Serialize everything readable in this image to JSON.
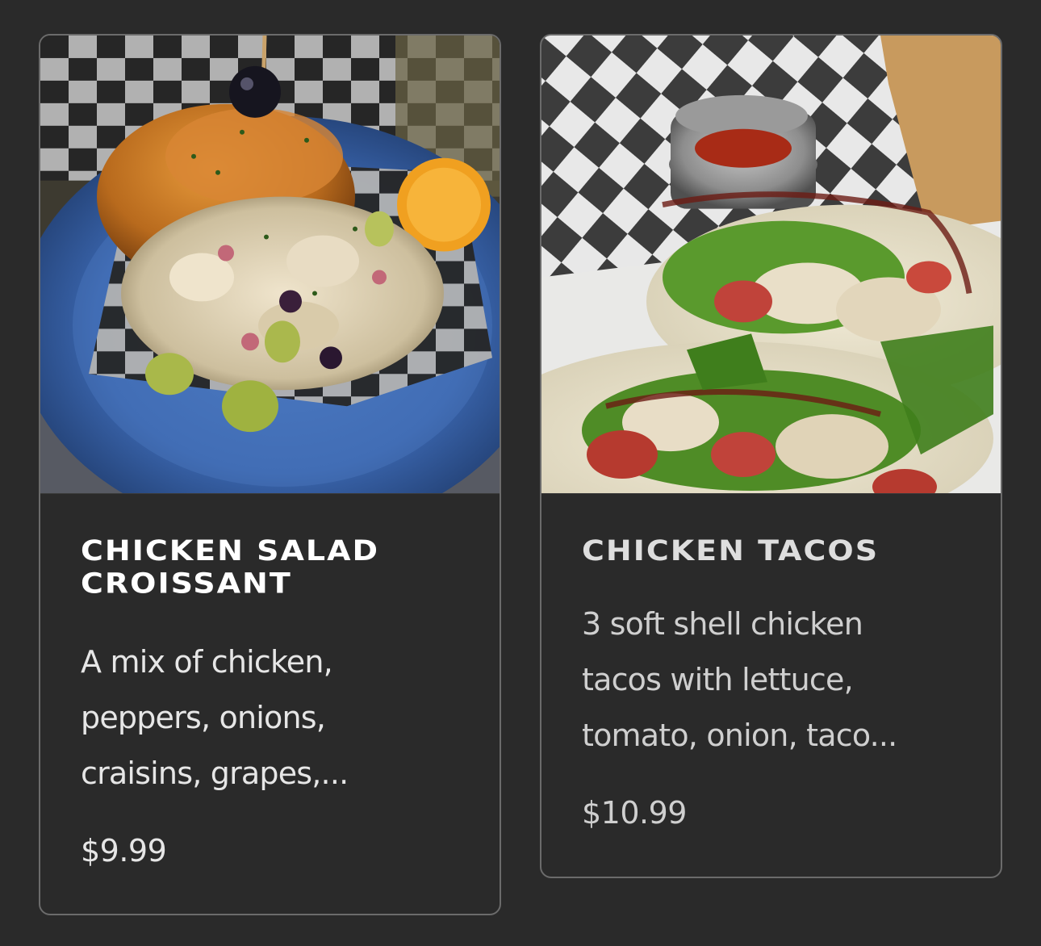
{
  "menu_items": [
    {
      "title": "Chicken Salad Croissant",
      "description": "A mix of chicken, peppers, onions, craisins, grapes,...",
      "price": "$9.99",
      "image_icon": "chicken-salad-croissant-photo"
    },
    {
      "title": "Chicken Tacos",
      "description": "3 soft shell chicken tacos with lettuce, tomato, onion, taco...",
      "price": "$10.99",
      "image_icon": "chicken-tacos-photo"
    }
  ],
  "colors": {
    "page_background": "#2a2a2a",
    "card_border": "#6b6b6b",
    "title_text": "#ffffff",
    "body_text": "#e6e6e6"
  }
}
